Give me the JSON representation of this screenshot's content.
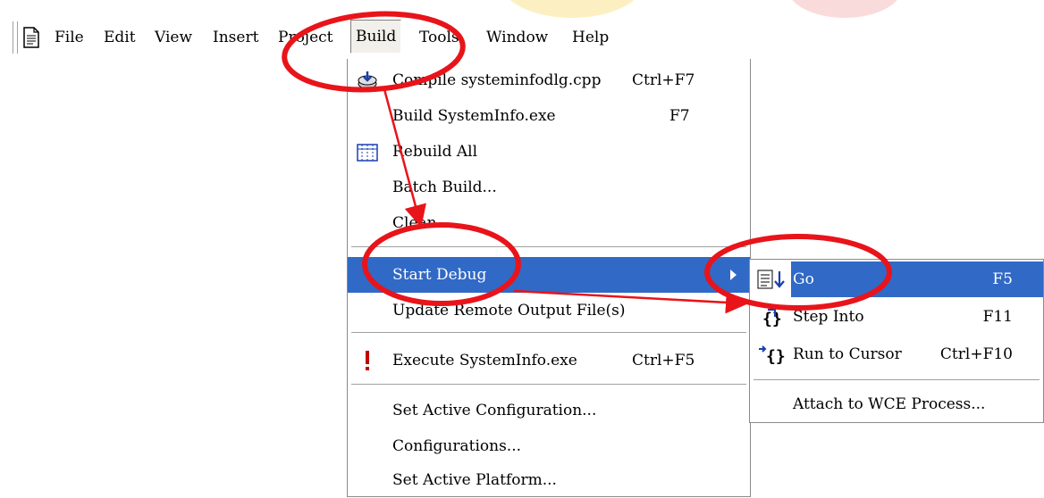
{
  "menubar": {
    "items": [
      {
        "label": "File"
      },
      {
        "label": "Edit"
      },
      {
        "label": "View"
      },
      {
        "label": "Insert"
      },
      {
        "label": "Project"
      },
      {
        "label": "Build"
      },
      {
        "label": "Tools"
      },
      {
        "label": "Window"
      },
      {
        "label": "Help"
      }
    ]
  },
  "build_menu": {
    "items": [
      {
        "label": "Compile systeminfodlg.cpp",
        "shortcut": "Ctrl+F7",
        "icon": "compile-icon"
      },
      {
        "label": "Build SystemInfo.exe",
        "shortcut": "F7"
      },
      {
        "label": "Rebuild All",
        "icon": "rebuild-icon"
      },
      {
        "label": "Batch Build..."
      },
      {
        "label": "Clean"
      },
      {
        "label": "Start Debug",
        "submenu": true
      },
      {
        "label": "Update Remote Output File(s)"
      },
      {
        "label": "Execute SystemInfo.exe",
        "shortcut": "Ctrl+F5",
        "icon": "exclamation-icon"
      },
      {
        "label": "Set Active Configuration..."
      },
      {
        "label": "Configurations..."
      },
      {
        "label": "Set Active Platform..."
      }
    ]
  },
  "debug_submenu": {
    "items": [
      {
        "label": "Go",
        "shortcut": "F5",
        "icon": "go-icon"
      },
      {
        "label": "Step Into",
        "shortcut": "F11",
        "icon": "step-into-icon"
      },
      {
        "label": "Run to Cursor",
        "shortcut": "Ctrl+F10",
        "icon": "run-to-cursor-icon"
      },
      {
        "label": "Attach to WCE Process..."
      }
    ]
  },
  "colors": {
    "highlight": "#3169c6",
    "annotation": "#e8141a"
  }
}
